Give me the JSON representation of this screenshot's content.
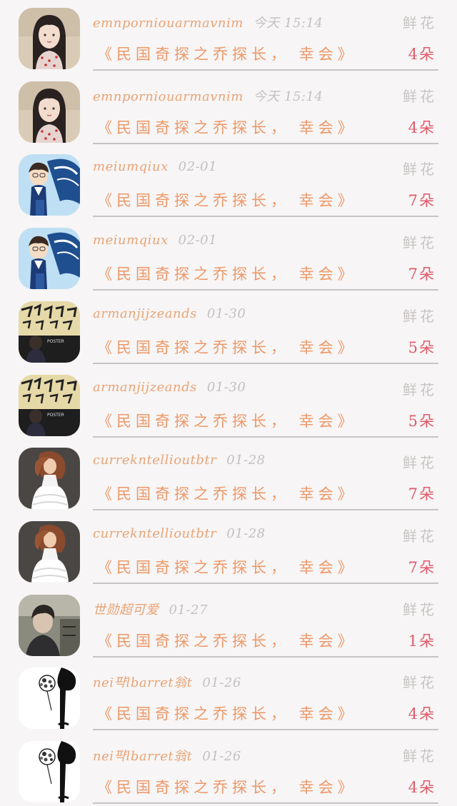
{
  "gift_list": {
    "items": [
      {
        "username": "emnporniouarmavnim",
        "time": "今天 15:14",
        "gift_type": "鲜花",
        "title": "《民国奇探之乔探长， 幸会》",
        "count": "4朵",
        "avatar": "avatar-girl"
      },
      {
        "username": "emnporniouarmavnim",
        "time": "今天 15:14",
        "gift_type": "鲜花",
        "title": "《民国奇探之乔探长， 幸会》",
        "count": "4朵",
        "avatar": "avatar-girl"
      },
      {
        "username": "meiumqiux",
        "time": "02-01",
        "gift_type": "鲜花",
        "title": "《民国奇探之乔探长， 幸会》",
        "count": "7朵",
        "avatar": "avatar-anime"
      },
      {
        "username": "meiumqiux",
        "time": "02-01",
        "gift_type": "鲜花",
        "title": "《民国奇探之乔探长， 幸会》",
        "count": "7朵",
        "avatar": "avatar-anime"
      },
      {
        "username": "armanjijzeands",
        "time": "01-30",
        "gift_type": "鲜花",
        "title": "《民国奇探之乔探长， 幸会》",
        "count": "5朵",
        "avatar": "avatar-poster"
      },
      {
        "username": "armanjijzeands",
        "time": "01-30",
        "gift_type": "鲜花",
        "title": "《民国奇探之乔探长， 幸会》",
        "count": "5朵",
        "avatar": "avatar-poster"
      },
      {
        "username": "currekntellioutbtr",
        "time": "01-28",
        "gift_type": "鲜花",
        "title": "《民国奇探之乔探长， 幸会》",
        "count": "7朵",
        "avatar": "avatar-dress"
      },
      {
        "username": "currekntellioutbtr",
        "time": "01-28",
        "gift_type": "鲜花",
        "title": "《民国奇探之乔探长， 幸会》",
        "count": "7朵",
        "avatar": "avatar-dress"
      },
      {
        "username": "世勋超可爱",
        "time": "01-27",
        "gift_type": "鲜花",
        "title": "《民国奇探之乔探长， 幸会》",
        "count": "1朵",
        "avatar": "avatar-man"
      },
      {
        "username": "nei퍅lbarret翁t",
        "time": "01-26",
        "gift_type": "鲜花",
        "title": "《民国奇探之乔探长， 幸会》",
        "count": "4朵",
        "avatar": "avatar-sketch"
      },
      {
        "username": "nei퍅lbarret翁t",
        "time": "01-26",
        "gift_type": "鲜花",
        "title": "《民国奇探之乔探长， 幸会》",
        "count": "4朵",
        "avatar": "avatar-sketch"
      }
    ]
  }
}
